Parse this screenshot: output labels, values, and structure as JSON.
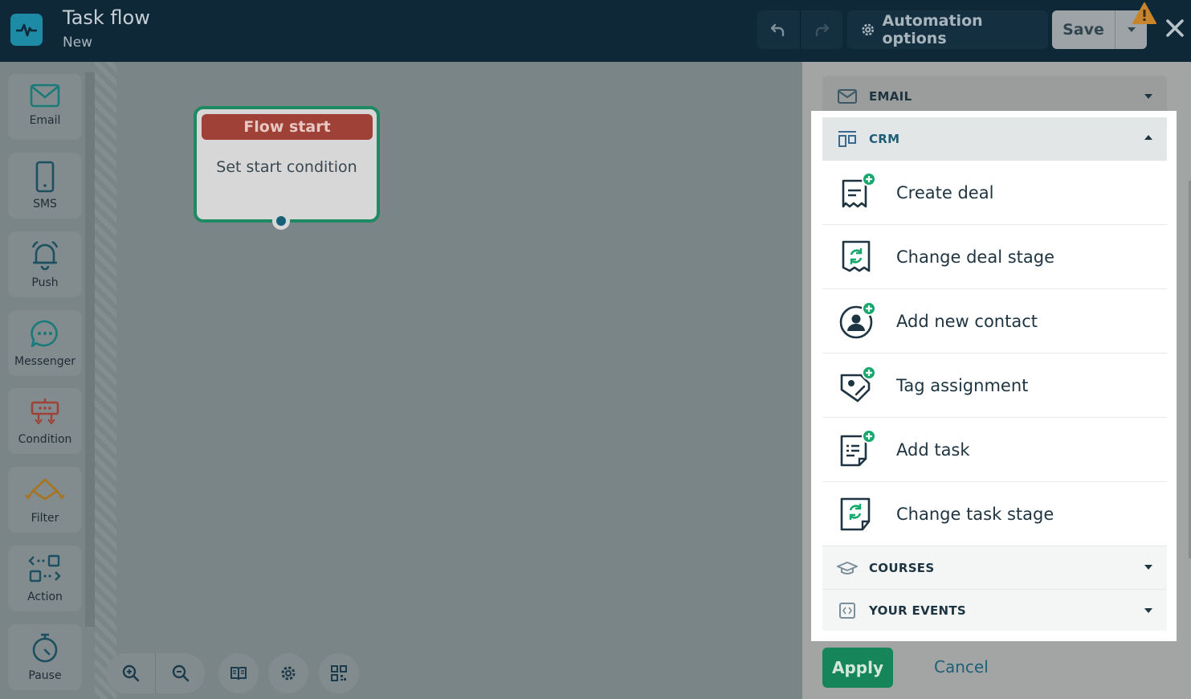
{
  "header": {
    "title": "Task flow",
    "subtitle": "New",
    "automation_label": "Automation options",
    "save_label": "Save"
  },
  "toolbox": {
    "items": [
      {
        "label": "Email",
        "icon": "mail-icon"
      },
      {
        "label": "SMS",
        "icon": "phone-icon"
      },
      {
        "label": "Push",
        "icon": "bell-icon"
      },
      {
        "label": "Messenger",
        "icon": "chat-icon"
      },
      {
        "label": "Condition",
        "icon": "condition-icon"
      },
      {
        "label": "Filter",
        "icon": "filter-icon"
      },
      {
        "label": "Action",
        "icon": "action-icon"
      },
      {
        "label": "Pause",
        "icon": "timer-icon"
      }
    ]
  },
  "canvas": {
    "node_title": "Flow start",
    "node_body": "Set start condition"
  },
  "panel": {
    "email_section": "EMAIL",
    "crm_section": "CRM",
    "crm_items": [
      {
        "label": "Create deal",
        "icon": "create-deal-icon"
      },
      {
        "label": "Change deal stage",
        "icon": "change-deal-stage-icon"
      },
      {
        "label": "Add new contact",
        "icon": "add-contact-icon"
      },
      {
        "label": "Tag assignment",
        "icon": "tag-icon"
      },
      {
        "label": "Add task",
        "icon": "add-task-icon"
      },
      {
        "label": "Change task stage",
        "icon": "change-task-stage-icon"
      }
    ],
    "courses_section": "COURSES",
    "events_section": "YOUR EVENTS",
    "apply_label": "Apply",
    "cancel_label": "Cancel"
  },
  "colors": {
    "header_bg": "#0e2838",
    "accent_green": "#17855a",
    "flow_head_red": "#a04138",
    "crm_text": "#1e3440"
  }
}
